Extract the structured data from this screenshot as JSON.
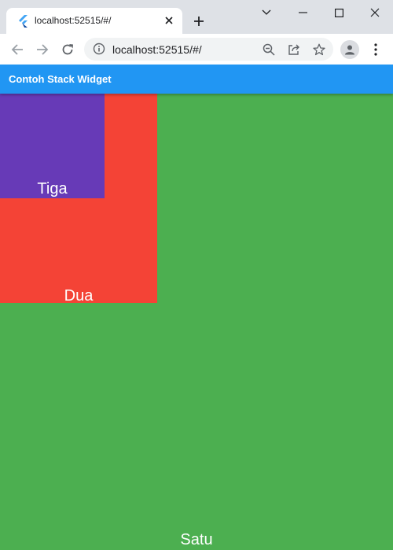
{
  "browser": {
    "tab_title": "localhost:52515/#/",
    "url": "localhost:52515/#/"
  },
  "app": {
    "title": "Contoh Stack Widget",
    "bar_color": "#2196f3"
  },
  "stack": {
    "satu": {
      "label": "Satu",
      "color": "#4caf50"
    },
    "dua": {
      "label": "Dua",
      "color": "#f44336"
    },
    "tiga": {
      "label": "Tiga",
      "color": "#673ab7"
    }
  },
  "icons": {
    "tab": [
      "flutter-icon",
      "close-icon",
      "plus-icon"
    ],
    "window": [
      "chevron-down-icon",
      "minimize-icon",
      "maximize-icon",
      "close-icon"
    ],
    "toolbar": [
      "back-arrow-icon",
      "forward-arrow-icon",
      "reload-icon",
      "info-icon",
      "zoom-icon",
      "share-icon",
      "star-icon",
      "profile-icon",
      "menu-dots-icon"
    ]
  }
}
